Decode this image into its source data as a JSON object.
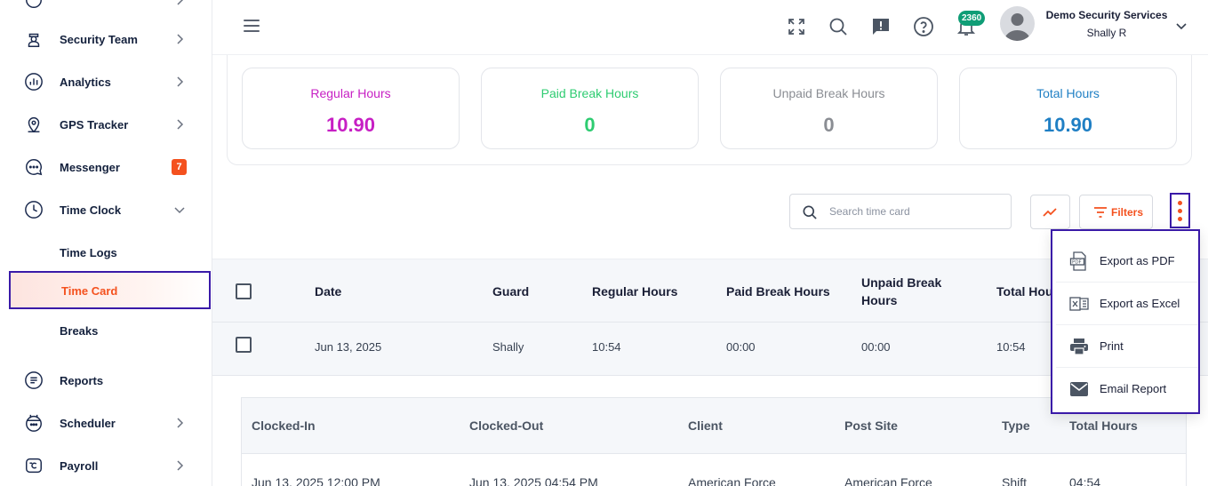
{
  "sidebar": {
    "items": [
      {
        "label": "Security Team",
        "icon": "guard-icon"
      },
      {
        "label": "Analytics",
        "icon": "analytics-icon"
      },
      {
        "label": "GPS Tracker",
        "icon": "location-pin-icon"
      },
      {
        "label": "Messenger",
        "icon": "chat-icon",
        "badge": "7"
      },
      {
        "label": "Time Clock",
        "icon": "clock-icon"
      },
      {
        "label": "Reports",
        "icon": "reports-icon"
      },
      {
        "label": "Scheduler",
        "icon": "calendar-icon"
      },
      {
        "label": "Payroll",
        "icon": "payroll-icon"
      }
    ],
    "time_clock_sub": [
      "Time Logs",
      "Time Card",
      "Breaks"
    ]
  },
  "header": {
    "notification_count": "2360",
    "org_name": "Demo Security Services",
    "user_name": "Shally R"
  },
  "summary": [
    {
      "label": "Regular Hours",
      "value": "10.90",
      "color": "#c71fc4"
    },
    {
      "label": "Paid Break Hours",
      "value": "0",
      "color": "#2ecc71"
    },
    {
      "label": "Unpaid Break Hours",
      "value": "0",
      "color": "#8a8d93"
    },
    {
      "label": "Total Hours",
      "value": "10.90",
      "color": "#1f7fc4"
    }
  ],
  "toolbar": {
    "search_placeholder": "Search time card",
    "filters_label": "Filters"
  },
  "table": {
    "headers": [
      "Date",
      "Guard",
      "Regular Hours",
      "Paid Break Hours",
      "Unpaid Break",
      "Hours",
      "Total Hou"
    ],
    "row": [
      "Jun 13, 2025",
      "Shally",
      "10:54",
      "00:00",
      "00:00",
      "10:54"
    ]
  },
  "nested": {
    "headers": [
      "Clocked-In",
      "Clocked-Out",
      "Client",
      "Post Site",
      "Type",
      "Total Hours"
    ],
    "row": [
      "Jun 13, 2025 12:00 PM",
      "Jun 13, 2025 04:54 PM",
      "American Force",
      "American Force",
      "Shift",
      "04:54"
    ]
  },
  "export_menu": [
    {
      "label": "Export as PDF",
      "icon": "pdf-icon"
    },
    {
      "label": "Export as Excel",
      "icon": "excel-icon"
    },
    {
      "label": "Print",
      "icon": "printer-icon"
    },
    {
      "label": "Email Report",
      "icon": "email-icon"
    }
  ],
  "colors": {
    "accent": "#f4511e",
    "highlight_border": "#3a1aa8",
    "badge_green": "#0f9d76"
  }
}
